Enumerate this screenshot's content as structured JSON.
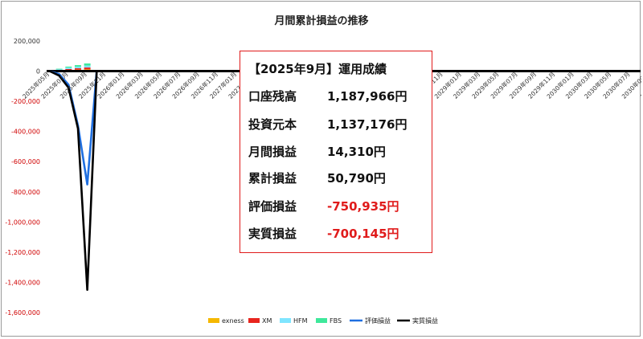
{
  "chart_data": {
    "type": "line",
    "title": "月間累計損益の推移",
    "ylim": [
      -1600000,
      200000
    ],
    "y_ticks": [
      "200,000",
      "0",
      "-200,000",
      "-400,000",
      "-600,000",
      "-800,000",
      "-1,000,000",
      "-1,200,000",
      "-1,400,000",
      "-1,600,000"
    ],
    "y_tick_values": [
      200000,
      0,
      -200000,
      -400000,
      -600000,
      -800000,
      -1000000,
      -1200000,
      -1400000,
      -1600000
    ],
    "categories": [
      "2025年05月",
      "2025年07月",
      "2025年09月",
      "2025年11月",
      "2026年01月",
      "2026年03月",
      "2026年05月",
      "2026年07月",
      "2026年09月",
      "2026年11月",
      "2027年01月",
      "2027年03月",
      "2027年05月",
      "2027年07月",
      "2027年09月",
      "2027年11月",
      "2028年01月",
      "2028年03月",
      "2028年05月",
      "2028年07月",
      "2028年09月",
      "2028年11月",
      "2029年01月",
      "2029年03月",
      "2029年05月",
      "2029年07月",
      "2029年09月",
      "2029年11月",
      "2030年01月",
      "2030年03月",
      "2030年05月",
      "2030年07月",
      "2030年09月",
      "2030年11月",
      "2031年01月"
    ],
    "months": [
      "2025年05月",
      "2025年06月",
      "2025年07月",
      "2025年08月",
      "2025年09月"
    ],
    "bar_series": [
      {
        "name": "exness",
        "color": "#f5b800",
        "values": [
          0,
          4000,
          8000,
          10000,
          12000
        ]
      },
      {
        "name": "XM",
        "color": "#e8251e",
        "values": [
          0,
          3000,
          6000,
          9000,
          12000
        ]
      },
      {
        "name": "HFM",
        "color": "#7fe5ff",
        "values": [
          0,
          5000,
          9000,
          11000,
          13000
        ]
      },
      {
        "name": "FBS",
        "color": "#3ee89b",
        "values": [
          0,
          4000,
          7000,
          10000,
          14000
        ]
      }
    ],
    "line_series": [
      {
        "name": "評価損益",
        "color": "#1f6fe0",
        "values": [
          0,
          -20000,
          -90000,
          -360000,
          -750935,
          0
        ]
      },
      {
        "name": "実質損益",
        "color": "#000000",
        "values": [
          0,
          -30000,
          -110000,
          -380000,
          -1450000,
          0
        ]
      }
    ],
    "legend_position": "bottom",
    "grid": false
  },
  "stats": {
    "heading": "【2025年9月】運用成績",
    "rows": [
      {
        "label": "口座残高",
        "value": "1,187,966円",
        "negative": false
      },
      {
        "label": "投資元本",
        "value": "1,137,176円",
        "negative": false
      },
      {
        "label": "月間損益",
        "value": "14,310円",
        "negative": false
      },
      {
        "label": "累計損益",
        "value": "50,790円",
        "negative": false
      },
      {
        "label": "評価損益",
        "value": "-750,935円",
        "negative": true
      },
      {
        "label": "実質損益",
        "value": "-700,145円",
        "negative": true
      }
    ],
    "border_color": "#e01b1b"
  }
}
